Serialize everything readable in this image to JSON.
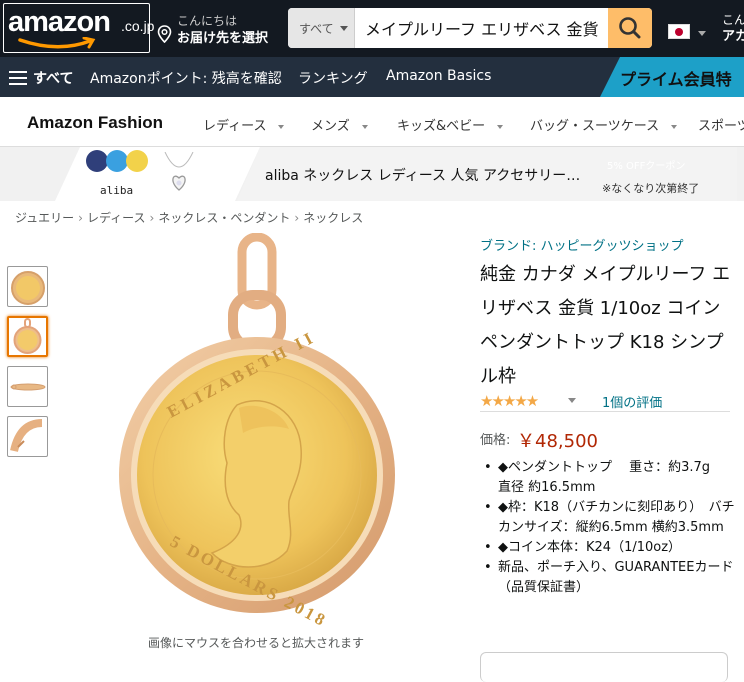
{
  "header": {
    "logo_text": "amazon",
    "logo_suffix": ".co.jp",
    "deliver_line1": "こんにちは",
    "deliver_line2": "お届け先を選択",
    "search_category": "すべて",
    "search_value": "メイプルリーフ エリザベス 金貨",
    "account_line1": "こん",
    "account_line2": "アカ"
  },
  "nav": {
    "menu_label": "すべて",
    "links": [
      "Amazonポイント: 残高を確認",
      "ランキング",
      "Amazon Basics"
    ],
    "prime_label": "プライム会員特"
  },
  "fashion": {
    "brand": "Amazon Fashion",
    "items": [
      "レディース",
      "メンズ",
      "キッズ&ベビー",
      "バッグ・スーツケース",
      "スポーツ"
    ]
  },
  "ad": {
    "logo": "aliba",
    "text": "aliba ネックレス レディース 人気 アクセサリー…",
    "coupon": "5% OFFクーポン",
    "note": "※なくなり次第終了"
  },
  "breadcrumb": [
    "ジュエリー",
    "レディース",
    "ネックレス・ペンダント",
    "ネックレス"
  ],
  "gallery": {
    "zoom_hint": "画像にマウスを合わせると拡大されます",
    "coin_text_top": "ELIZABETH II",
    "coin_text_bottom": "5 DOLLARS 2018"
  },
  "product": {
    "brand_link": "ブランド: ハッピーグッツショップ",
    "title": "純金 カナダ メイプルリーフ エリザベス 金貨 1/10oz コイン ペンダントトップ K18 シンプル枠",
    "stars": "★★★★★",
    "review_count": "1個の評価",
    "price_label": "価格:",
    "price": "￥48,500",
    "bullets": [
      "◆ペンダントトップ　 重さ：約3.7g　直径 約16.5mm",
      "◆枠：K18（バチカンに刻印あり）　バチカンサイズ：縦約6.5mm 横約3.5mm",
      "◆コイン本体：K24（1/10oz）",
      "新品、ポーチ入り、GUARANTEEカード（品質保証書）"
    ]
  },
  "colors": {
    "topbar": "#131921",
    "navbar": "#232f3e",
    "search_button": "#febd69",
    "link": "#007185",
    "price": "#b12704",
    "prime": "#1da0c8"
  }
}
